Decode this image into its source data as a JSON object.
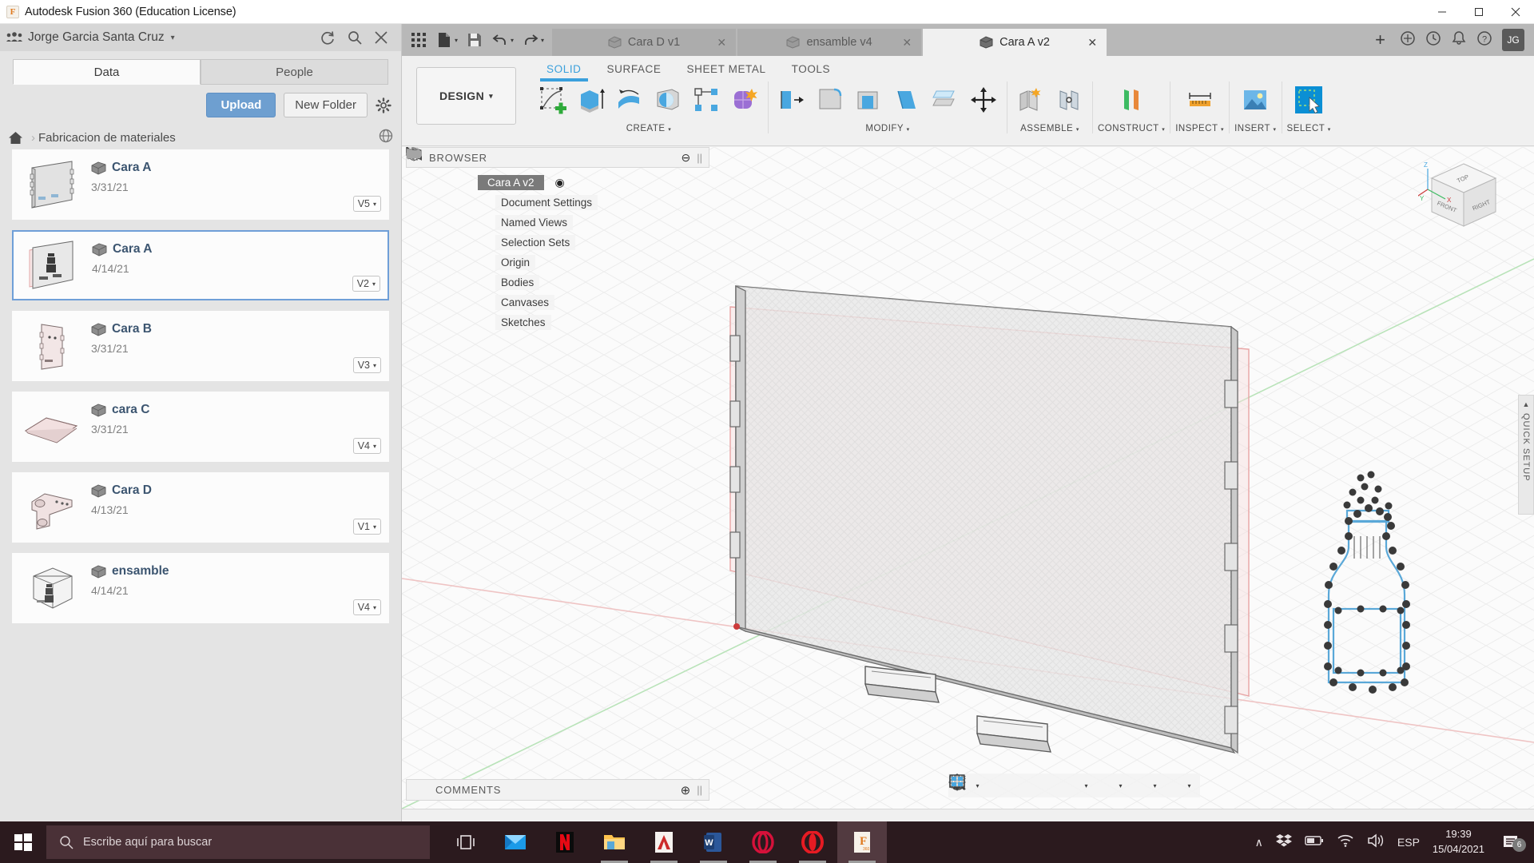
{
  "window": {
    "title": "Autodesk Fusion 360 (Education License)",
    "app_icon": "fusion-logo-icon",
    "minimize": "–",
    "maximize": "☐",
    "close": "✕"
  },
  "data_panel": {
    "user_name": "Jorge Garcia Santa Cruz",
    "user_caret": "▾",
    "icons": {
      "refresh": "refresh-icon",
      "search": "search-icon",
      "close": "close-icon",
      "settings": "gear-icon",
      "globe": "globe-icon",
      "home": "home-icon"
    },
    "tabs": [
      {
        "label": "Data",
        "active": true
      },
      {
        "label": "People",
        "active": false
      }
    ],
    "upload_label": "Upload",
    "new_folder_label": "New Folder",
    "breadcrumb": {
      "home": "⌂",
      "separator": "›",
      "folder": "Fabricacion de materiales"
    },
    "files": [
      {
        "name": "Cara A",
        "date": "3/31/21",
        "version": "V5",
        "selected": false,
        "thumb": "panel-plain"
      },
      {
        "name": "Cara A",
        "date": "4/14/21",
        "version": "V2",
        "selected": true,
        "thumb": "panel-canvas"
      },
      {
        "name": "Cara B",
        "date": "3/31/21",
        "version": "V3",
        "selected": false,
        "thumb": "panel-tall"
      },
      {
        "name": "cara C",
        "date": "3/31/21",
        "version": "V4",
        "selected": false,
        "thumb": "panel-flat"
      },
      {
        "name": "Cara D",
        "date": "4/13/21",
        "version": "V1",
        "selected": false,
        "thumb": "bracket"
      },
      {
        "name": "ensamble",
        "date": "4/14/21",
        "version": "V4",
        "selected": false,
        "thumb": "assembly"
      }
    ]
  },
  "tab_strip": {
    "quick_access": [
      {
        "name": "app-grid-icon"
      },
      {
        "name": "new-document-icon",
        "caret": "▾"
      },
      {
        "name": "save-icon"
      },
      {
        "name": "undo-icon",
        "caret": "▾"
      },
      {
        "name": "redo-icon",
        "caret": "▾"
      }
    ],
    "documents": [
      {
        "label": "Cara D v1",
        "active": false,
        "close": "✕"
      },
      {
        "label": "ensamble v4",
        "active": false,
        "close": "✕"
      },
      {
        "label": "Cara A v2",
        "active": true,
        "close": "✕"
      }
    ],
    "new_tab": "+",
    "right_icons": [
      "extensions-icon",
      "job-status-icon",
      "notifications-icon",
      "help-icon"
    ],
    "avatar_initials": "JG"
  },
  "ribbon": {
    "workspace_label": "DESIGN",
    "workspace_caret": "▾",
    "tabs": [
      {
        "label": "SOLID",
        "active": true
      },
      {
        "label": "SURFACE",
        "active": false
      },
      {
        "label": "SHEET METAL",
        "active": false
      },
      {
        "label": "TOOLS",
        "active": false
      }
    ],
    "groups": [
      {
        "label": "CREATE",
        "caret": "▾",
        "items": [
          "create-sketch-icon",
          "extrude-icon",
          "revolve-icon",
          "sweep-icon",
          "pattern-icon",
          "form-icon"
        ]
      },
      {
        "label": "MODIFY",
        "caret": "▾",
        "items": [
          "press-pull-icon",
          "fillet-icon",
          "shell-icon",
          "draft-icon",
          "scale-icon",
          "move-copy-icon"
        ]
      },
      {
        "label": "ASSEMBLE",
        "caret": "▾",
        "items": [
          "new-component-icon",
          "joint-icon"
        ]
      },
      {
        "label": "CONSTRUCT",
        "caret": "▾",
        "items": [
          "offset-plane-icon"
        ]
      },
      {
        "label": "INSPECT",
        "caret": "▾",
        "items": [
          "measure-icon"
        ]
      },
      {
        "label": "INSERT",
        "caret": "▾",
        "items": [
          "insert-canvas-icon"
        ]
      },
      {
        "label": "SELECT",
        "caret": "▾",
        "items": [
          "select-icon"
        ]
      }
    ]
  },
  "browser": {
    "title": "BROWSER",
    "collapse_icon": "◂◂",
    "minus_icon": "⊖",
    "tree": [
      {
        "label": "Cara A v2",
        "level": 0,
        "eye": "visible",
        "icon": "component-icon",
        "root": true,
        "radio": "◉"
      },
      {
        "label": "Document Settings",
        "level": 1,
        "eye": "none",
        "icon": "gear-icon"
      },
      {
        "label": "Named Views",
        "level": 1,
        "eye": "none",
        "icon": "folder-icon"
      },
      {
        "label": "Selection Sets",
        "level": 1,
        "eye": "none",
        "icon": "folder-icon"
      },
      {
        "label": "Origin",
        "level": 1,
        "eye": "hidden",
        "icon": "folder-icon"
      },
      {
        "label": "Bodies",
        "level": 1,
        "eye": "visible",
        "icon": "folder-icon"
      },
      {
        "label": "Canvases",
        "level": 1,
        "eye": "visible",
        "icon": "folder-icon"
      },
      {
        "label": "Sketches",
        "level": 1,
        "eye": "visible",
        "icon": "folder-icon"
      }
    ]
  },
  "viewcube": {
    "faces": [
      "TOP",
      "FRONT",
      "RIGHT"
    ],
    "axis_labels": [
      "X",
      "Y",
      "Z"
    ]
  },
  "quick_setup": {
    "label": "QUICK SETUP",
    "arrow": "▲"
  },
  "comments": {
    "title": "COMMENTS",
    "add_icon": "⊕"
  },
  "nav_bar": {
    "items": [
      {
        "name": "orbit-icon",
        "caret": "▾"
      },
      {
        "name": "look-at-icon",
        "caret": ""
      },
      {
        "name": "pan-icon",
        "caret": ""
      },
      {
        "name": "zoom-icon",
        "caret": ""
      },
      {
        "name": "zoom-window-icon",
        "caret": "▾"
      },
      {
        "name": "display-settings-icon",
        "caret": "▾"
      },
      {
        "name": "grid-snaps-icon",
        "caret": "▾"
      },
      {
        "name": "viewports-icon",
        "caret": "▾"
      }
    ]
  },
  "timeline": {
    "controls": [
      "go-to-beginning-icon",
      "step-back-icon",
      "play-icon",
      "step-forward-icon",
      "go-to-end-icon"
    ],
    "features": [
      "sketch-feature-icon",
      "extrude-feature-icon",
      "sketch-feature-icon",
      "canvas-feature-icon",
      "filter-icon"
    ],
    "settings_icon": "gear-icon"
  },
  "taskbar": {
    "start_icon": "windows-start-icon",
    "search_placeholder": "Escribe aquí para buscar",
    "search_icon": "search-icon",
    "task_view_icon": "task-view-icon",
    "apps": [
      {
        "name": "mail-icon",
        "running": false
      },
      {
        "name": "netflix-icon",
        "running": false
      },
      {
        "name": "file-explorer-icon",
        "running": true
      },
      {
        "name": "autodesk-icon",
        "running": true
      },
      {
        "name": "word-icon",
        "running": true
      },
      {
        "name": "opera-gx-icon",
        "running": true
      },
      {
        "name": "opera-icon",
        "running": true
      },
      {
        "name": "fusion360-icon",
        "running": true,
        "active": true
      }
    ],
    "tray": {
      "chevron": "∧",
      "icons": [
        "dropbox-icon",
        "battery-icon",
        "wifi-icon",
        "volume-icon"
      ],
      "language": "ESP",
      "time": "19:39",
      "date": "15/04/2021",
      "notifications_count": "6"
    }
  }
}
